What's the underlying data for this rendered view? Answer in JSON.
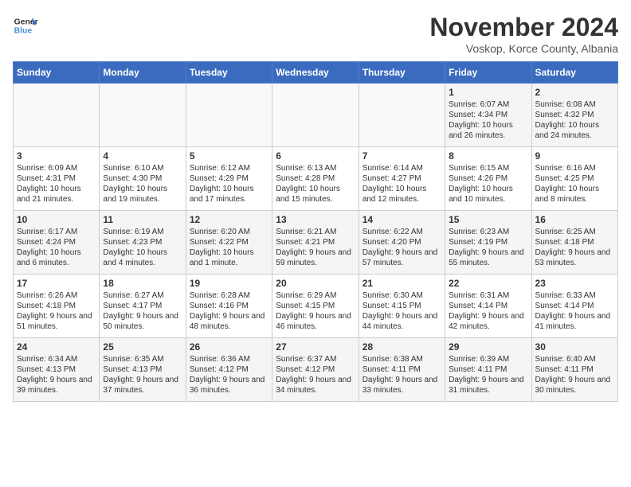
{
  "logo": {
    "line1": "General",
    "line2": "Blue"
  },
  "title": "November 2024",
  "subtitle": "Voskop, Korce County, Albania",
  "days_of_week": [
    "Sunday",
    "Monday",
    "Tuesday",
    "Wednesday",
    "Thursday",
    "Friday",
    "Saturday"
  ],
  "weeks": [
    [
      {
        "day": "",
        "info": ""
      },
      {
        "day": "",
        "info": ""
      },
      {
        "day": "",
        "info": ""
      },
      {
        "day": "",
        "info": ""
      },
      {
        "day": "",
        "info": ""
      },
      {
        "day": "1",
        "info": "Sunrise: 6:07 AM\nSunset: 4:34 PM\nDaylight: 10 hours and 26 minutes."
      },
      {
        "day": "2",
        "info": "Sunrise: 6:08 AM\nSunset: 4:32 PM\nDaylight: 10 hours and 24 minutes."
      }
    ],
    [
      {
        "day": "3",
        "info": "Sunrise: 6:09 AM\nSunset: 4:31 PM\nDaylight: 10 hours and 21 minutes."
      },
      {
        "day": "4",
        "info": "Sunrise: 6:10 AM\nSunset: 4:30 PM\nDaylight: 10 hours and 19 minutes."
      },
      {
        "day": "5",
        "info": "Sunrise: 6:12 AM\nSunset: 4:29 PM\nDaylight: 10 hours and 17 minutes."
      },
      {
        "day": "6",
        "info": "Sunrise: 6:13 AM\nSunset: 4:28 PM\nDaylight: 10 hours and 15 minutes."
      },
      {
        "day": "7",
        "info": "Sunrise: 6:14 AM\nSunset: 4:27 PM\nDaylight: 10 hours and 12 minutes."
      },
      {
        "day": "8",
        "info": "Sunrise: 6:15 AM\nSunset: 4:26 PM\nDaylight: 10 hours and 10 minutes."
      },
      {
        "day": "9",
        "info": "Sunrise: 6:16 AM\nSunset: 4:25 PM\nDaylight: 10 hours and 8 minutes."
      }
    ],
    [
      {
        "day": "10",
        "info": "Sunrise: 6:17 AM\nSunset: 4:24 PM\nDaylight: 10 hours and 6 minutes."
      },
      {
        "day": "11",
        "info": "Sunrise: 6:19 AM\nSunset: 4:23 PM\nDaylight: 10 hours and 4 minutes."
      },
      {
        "day": "12",
        "info": "Sunrise: 6:20 AM\nSunset: 4:22 PM\nDaylight: 10 hours and 1 minute."
      },
      {
        "day": "13",
        "info": "Sunrise: 6:21 AM\nSunset: 4:21 PM\nDaylight: 9 hours and 59 minutes."
      },
      {
        "day": "14",
        "info": "Sunrise: 6:22 AM\nSunset: 4:20 PM\nDaylight: 9 hours and 57 minutes."
      },
      {
        "day": "15",
        "info": "Sunrise: 6:23 AM\nSunset: 4:19 PM\nDaylight: 9 hours and 55 minutes."
      },
      {
        "day": "16",
        "info": "Sunrise: 6:25 AM\nSunset: 4:18 PM\nDaylight: 9 hours and 53 minutes."
      }
    ],
    [
      {
        "day": "17",
        "info": "Sunrise: 6:26 AM\nSunset: 4:18 PM\nDaylight: 9 hours and 51 minutes."
      },
      {
        "day": "18",
        "info": "Sunrise: 6:27 AM\nSunset: 4:17 PM\nDaylight: 9 hours and 50 minutes."
      },
      {
        "day": "19",
        "info": "Sunrise: 6:28 AM\nSunset: 4:16 PM\nDaylight: 9 hours and 48 minutes."
      },
      {
        "day": "20",
        "info": "Sunrise: 6:29 AM\nSunset: 4:15 PM\nDaylight: 9 hours and 46 minutes."
      },
      {
        "day": "21",
        "info": "Sunrise: 6:30 AM\nSunset: 4:15 PM\nDaylight: 9 hours and 44 minutes."
      },
      {
        "day": "22",
        "info": "Sunrise: 6:31 AM\nSunset: 4:14 PM\nDaylight: 9 hours and 42 minutes."
      },
      {
        "day": "23",
        "info": "Sunrise: 6:33 AM\nSunset: 4:14 PM\nDaylight: 9 hours and 41 minutes."
      }
    ],
    [
      {
        "day": "24",
        "info": "Sunrise: 6:34 AM\nSunset: 4:13 PM\nDaylight: 9 hours and 39 minutes."
      },
      {
        "day": "25",
        "info": "Sunrise: 6:35 AM\nSunset: 4:13 PM\nDaylight: 9 hours and 37 minutes."
      },
      {
        "day": "26",
        "info": "Sunrise: 6:36 AM\nSunset: 4:12 PM\nDaylight: 9 hours and 36 minutes."
      },
      {
        "day": "27",
        "info": "Sunrise: 6:37 AM\nSunset: 4:12 PM\nDaylight: 9 hours and 34 minutes."
      },
      {
        "day": "28",
        "info": "Sunrise: 6:38 AM\nSunset: 4:11 PM\nDaylight: 9 hours and 33 minutes."
      },
      {
        "day": "29",
        "info": "Sunrise: 6:39 AM\nSunset: 4:11 PM\nDaylight: 9 hours and 31 minutes."
      },
      {
        "day": "30",
        "info": "Sunrise: 6:40 AM\nSunset: 4:11 PM\nDaylight: 9 hours and 30 minutes."
      }
    ]
  ]
}
